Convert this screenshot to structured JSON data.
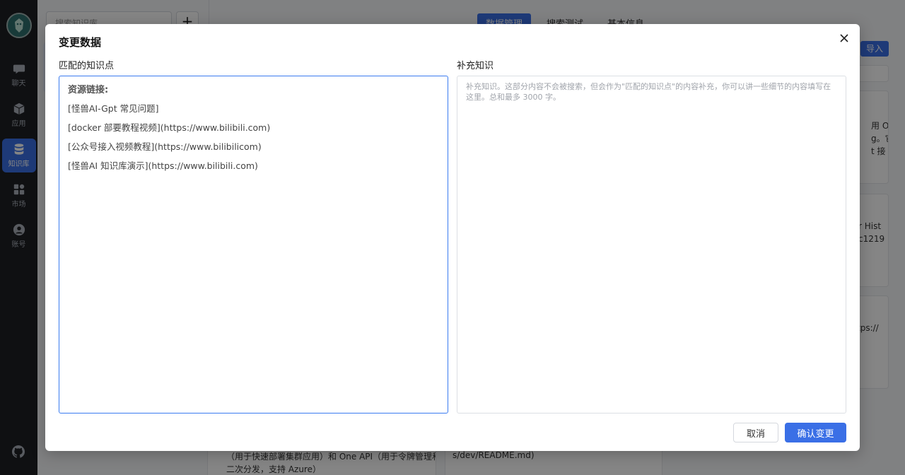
{
  "sidebar": {
    "items": [
      {
        "label": "聊天",
        "icon": "chat-icon"
      },
      {
        "label": "应用",
        "icon": "cube-icon"
      },
      {
        "label": "知识库",
        "icon": "database-icon",
        "active": true
      },
      {
        "label": "市场",
        "icon": "grid-icon"
      },
      {
        "label": "账号",
        "icon": "user-icon"
      }
    ]
  },
  "background": {
    "search_placeholder": "搜索知识库",
    "tabs": [
      "数据管理",
      "搜索测试",
      "基本信息"
    ],
    "import_label": "导入",
    "fragments": [
      "用 O",
      "g。它",
      "t 接",
      "r Hist",
      "c1219",
      "tps://",
      "（用于快速部署集群应用）和 One API（用于令牌管理和",
      "二次分发，支持 Azure）",
      "s/dev/README.md)"
    ]
  },
  "modal": {
    "title": "变更数据",
    "left_label": "匹配的知识点",
    "right_label": "补充知识",
    "resource_title": "资源链接:",
    "links": [
      "[怪兽AI-Gpt 常见问题]",
      "[docker 部要教程视频](https://www.bilibili.com)",
      "[公众号接入视频教程](https://www.bilibilicom)",
      "[怪兽AI 知识库演示](https://www.bilibili.com)"
    ],
    "supplement_placeholder": "补充知识。这部分内容不会被搜索，但会作为\"匹配的知识点\"的内容补充，你可以讲一些细节的内容填写在这里。总和最多 3000 字。",
    "cancel_label": "取消",
    "confirm_label": "确认变更"
  },
  "colors": {
    "accent": "#3a6fe6",
    "sidebar_bg": "#1d1f24"
  }
}
